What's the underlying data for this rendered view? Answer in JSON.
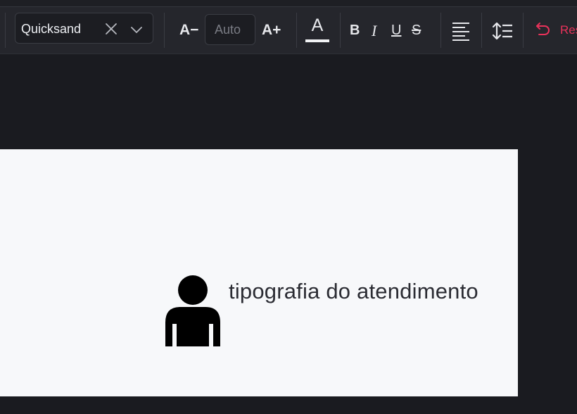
{
  "toolbar": {
    "font_family": {
      "value": "Quicksand",
      "clear_icon": "close-icon",
      "dropdown_icon": "chevron-down-icon"
    },
    "decrease_size_label": "A−",
    "size_placeholder": "Auto",
    "increase_size_label": "A+",
    "text_color": {
      "letter": "A",
      "swatch_color": "#f2f3f5"
    },
    "bold_label": "B",
    "italic_label": "I",
    "underline_label": "U",
    "strike_label": "S",
    "align_icon": "align-left-icon",
    "line_height_icon": "line-height-icon",
    "reset": {
      "icon": "undo-icon",
      "label": "Reset",
      "color": "#e8325a"
    }
  },
  "canvas": {
    "icon": "person-icon",
    "text": "tipografia do atendimento",
    "background": "#f7f8fa"
  },
  "colors": {
    "app_background": "#1a1b20",
    "toolbar_background": "#25262c",
    "accent": "#e8325a"
  }
}
